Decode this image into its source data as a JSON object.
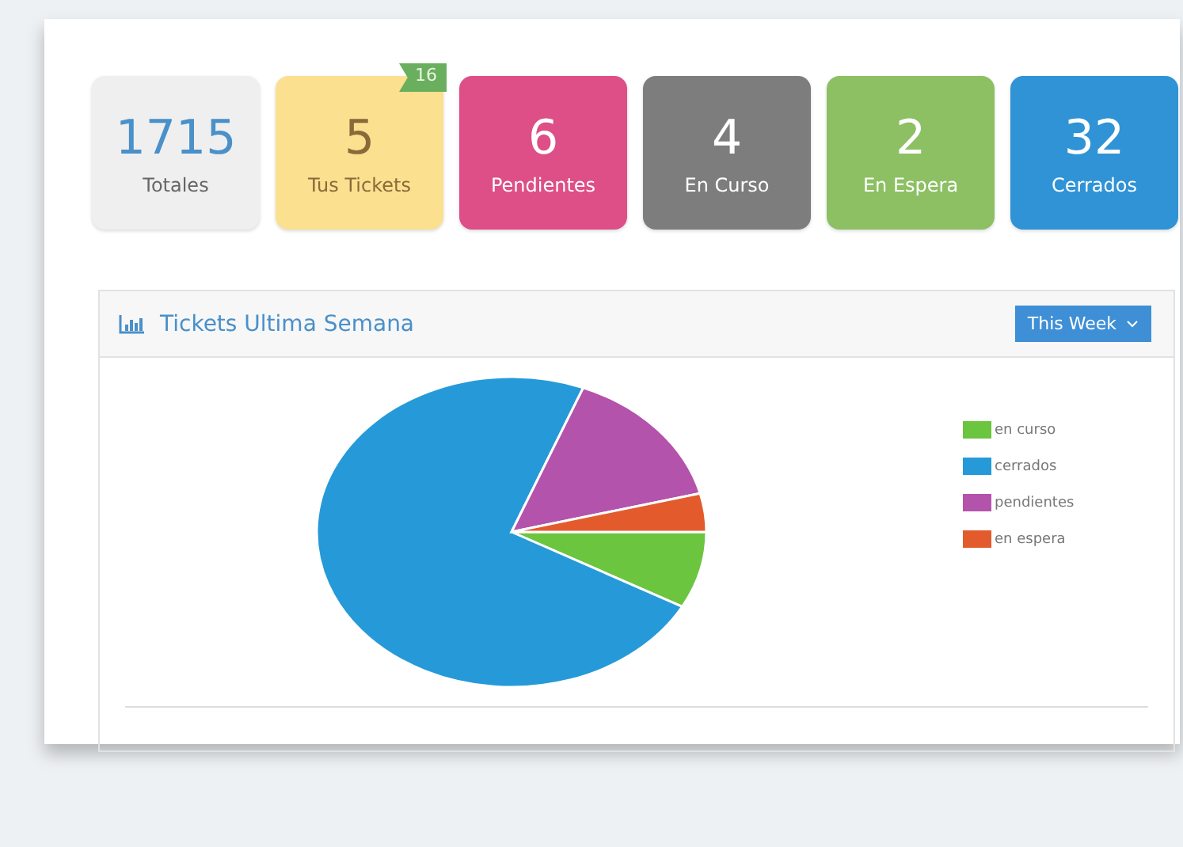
{
  "tiles": [
    {
      "value": "1715",
      "label": "Totales",
      "color": "#efefef",
      "kind": "light"
    },
    {
      "value": "5",
      "label": "Tus Tickets",
      "color": "#fbe08f",
      "kind": "warm",
      "badge": "16"
    },
    {
      "value": "6",
      "label": "Pendientes",
      "color": "#dd4f86",
      "kind": "dark"
    },
    {
      "value": "4",
      "label": "En Curso",
      "color": "#7d7d7d",
      "kind": "dark"
    },
    {
      "value": "2",
      "label": "En Espera",
      "color": "#8cc063",
      "kind": "dark"
    },
    {
      "value": "32",
      "label": "Cerrados",
      "color": "#2f93d6",
      "kind": "dark"
    }
  ],
  "panel": {
    "title": "Tickets Ultima Semana",
    "range_button": "This Week",
    "legend": [
      {
        "label": "en curso",
        "color": "#6cc53e"
      },
      {
        "label": "cerrados",
        "color": "#269ad8"
      },
      {
        "label": "pendientes",
        "color": "#b453ab"
      },
      {
        "label": "en espera",
        "color": "#e35b2c"
      }
    ]
  }
}
